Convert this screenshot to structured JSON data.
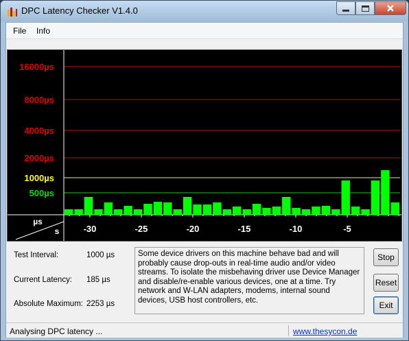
{
  "window": {
    "title": "DPC Latency Checker V1.4.0"
  },
  "menu": {
    "items": [
      "File",
      "Info"
    ]
  },
  "graph": {
    "y_labels": [
      {
        "text": "16000µs",
        "value": 16000,
        "color": "#e00000"
      },
      {
        "text": "8000µs",
        "value": 8000,
        "color": "#e00000"
      },
      {
        "text": "4000µs",
        "value": 4000,
        "color": "#e00000"
      },
      {
        "text": "2000µs",
        "value": 2000,
        "color": "#e00000"
      },
      {
        "text": "1000µs",
        "value": 1000,
        "color": "#ffff00"
      },
      {
        "text": "500µs",
        "value": 500,
        "color": "#00dd00"
      }
    ],
    "axis_corner": {
      "unit_y": "µs",
      "unit_x": "s"
    },
    "x_ticks": [
      "-30",
      "-25",
      "-20",
      "-15",
      "-10",
      "-5"
    ],
    "bar_color": "#00ff00",
    "bars": [
      0.08,
      0.08,
      0.26,
      0.08,
      0.18,
      0.08,
      0.13,
      0.08,
      0.16,
      0.19,
      0.18,
      0.08,
      0.26,
      0.15,
      0.15,
      0.18,
      0.08,
      0.12,
      0.08,
      0.16,
      0.1,
      0.12,
      0.26,
      0.1,
      0.08,
      0.12,
      0.13,
      0.08,
      0.5,
      0.12,
      0.08,
      0.5,
      0.65,
      0.18
    ]
  },
  "stats": {
    "test_interval": {
      "label": "Test Interval:",
      "value": "1000 µs"
    },
    "current_latency": {
      "label": "Current Latency:",
      "value": "185 µs"
    },
    "absolute_maximum": {
      "label": "Absolute Maximum:",
      "value": "2253 µs"
    }
  },
  "info_text": "Some device drivers on this machine behave bad and will probably cause drop-outs in real-time audio and/or video streams. To isolate the misbehaving driver use Device Manager and disable/re-enable various devices, one at a time. Try network and W-LAN adapters, modems, internal sound devices, USB host controllers, etc.",
  "buttons": {
    "stop": "Stop",
    "reset": "Reset",
    "exit": "Exit"
  },
  "status": {
    "text": "Analysing DPC latency ...",
    "link": "www.thesycon.de"
  }
}
